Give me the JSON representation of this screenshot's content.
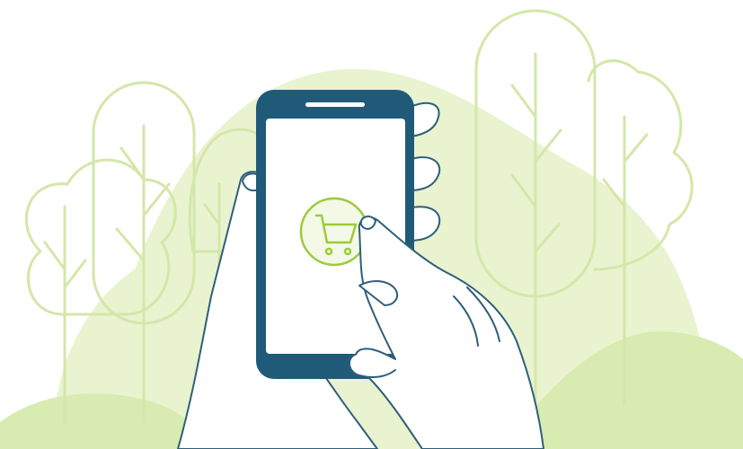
{
  "illustration": {
    "icon": "shopping-cart-icon",
    "colors": {
      "background": "#ffffff",
      "blob": "#e9f3cf",
      "hill": "#d8ebb0",
      "tree_line": "#d4e7a8",
      "phone_body": "#1f5b78",
      "phone_screen": "#ffffff",
      "cart_accent": "#9ccb3b",
      "hand_stroke": "#2e5f7a",
      "hand_fill": "#ffffff"
    }
  }
}
